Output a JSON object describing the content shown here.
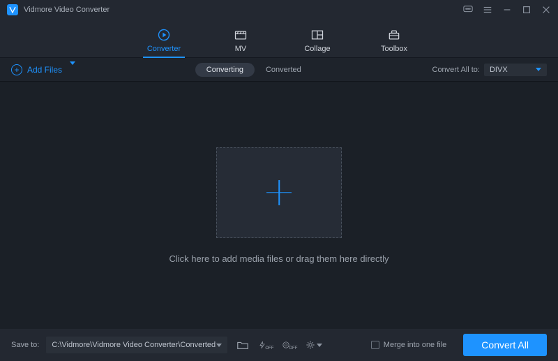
{
  "titlebar": {
    "title": "Vidmore Video Converter"
  },
  "tabs": {
    "converter": "Converter",
    "mv": "MV",
    "collage": "Collage",
    "toolbox": "Toolbox"
  },
  "subbar": {
    "add_files": "Add Files",
    "converting": "Converting",
    "converted": "Converted",
    "convert_all_to": "Convert All to:",
    "format": "DIVX"
  },
  "main": {
    "hint": "Click here to add media files or drag them here directly"
  },
  "bottombar": {
    "save_to": "Save to:",
    "path": "C:\\Vidmore\\Vidmore Video Converter\\Converted",
    "off1": "OFF",
    "off2": "OFF",
    "merge": "Merge into one file",
    "convert_all": "Convert All"
  }
}
